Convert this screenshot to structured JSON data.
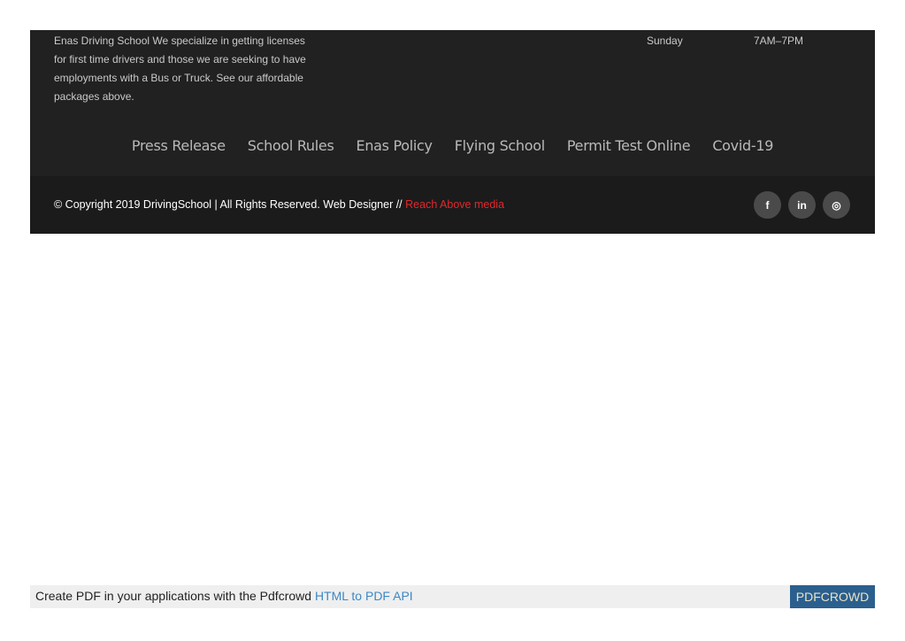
{
  "footer": {
    "about_lines": [
      "Enas Driving School We specialize in getting licenses",
      "for first time drivers and those we are seeking to have",
      "employments with a Bus or Truck. See our affordable",
      "packages above."
    ],
    "hours": {
      "day": "Sunday",
      "time": "7AM–7PM"
    },
    "nav": [
      "Press Release",
      "School Rules",
      "Enas Policy",
      "Flying School",
      "Permit Test Online",
      "Covid-19"
    ]
  },
  "bottom": {
    "copyright": "© Copyright 2019 DrivingSchool | All Rights Reserved. Web Designer // ",
    "designer_link": "Reach Above media",
    "socials": [
      {
        "icon": "facebook-icon",
        "glyph": "f"
      },
      {
        "icon": "linkedin-icon",
        "glyph": "in"
      },
      {
        "icon": "instagram-icon",
        "glyph": "◎"
      }
    ]
  },
  "pdfcrowd": {
    "text": "Create PDF in your applications with the Pdfcrowd ",
    "link": "HTML to PDF API",
    "badge": "PDFCROWD"
  },
  "colors": {
    "footer_bg": "#212121",
    "bottom_bg": "#1b1b1b",
    "accent_red": "#e0282c",
    "badge_bg": "#2b5f8e"
  }
}
